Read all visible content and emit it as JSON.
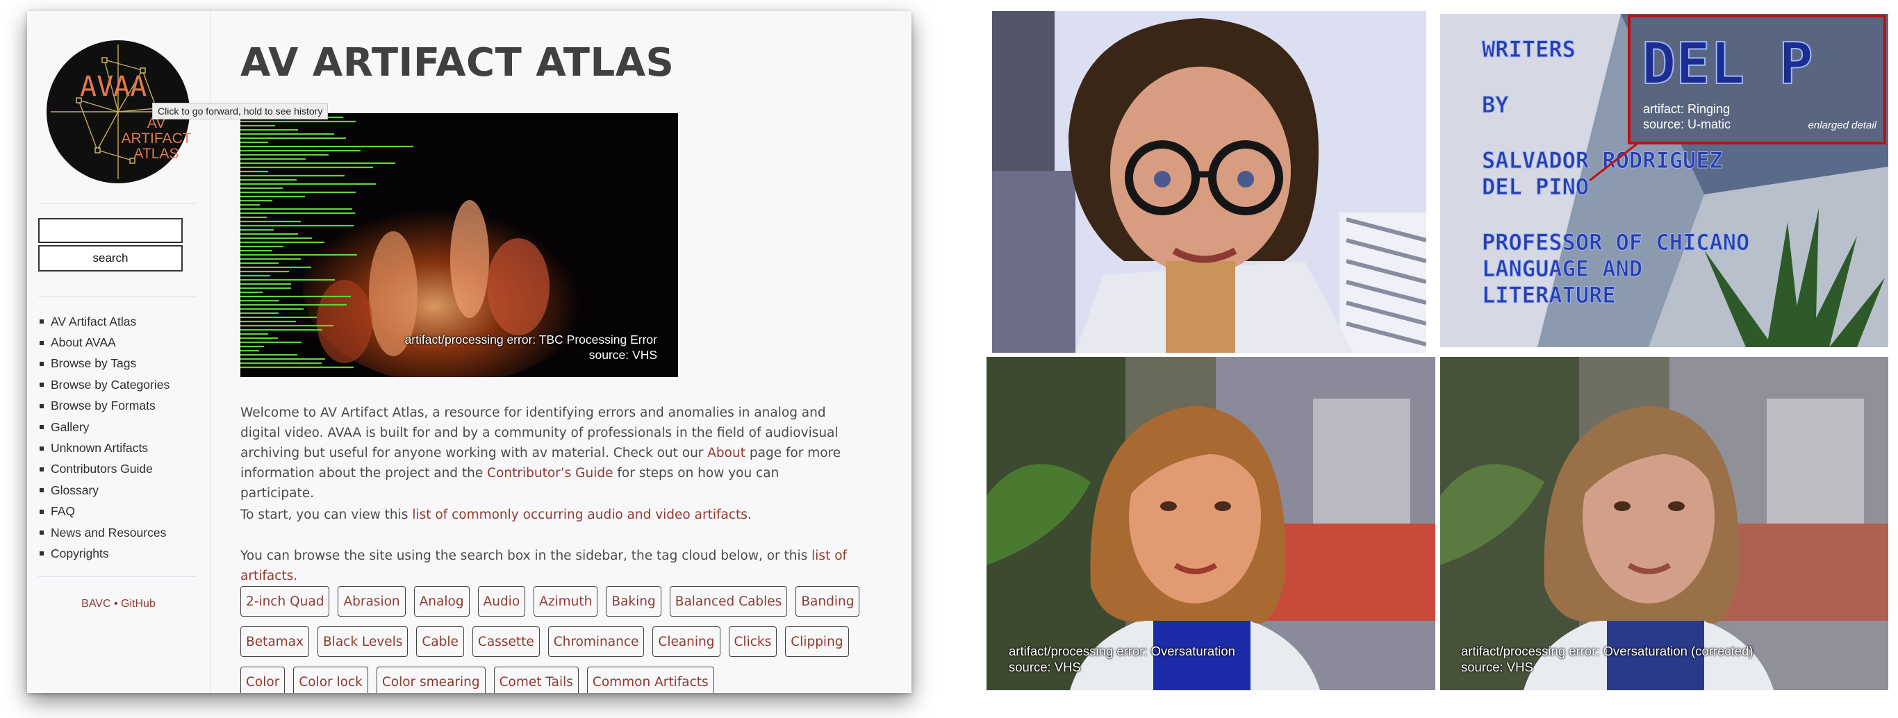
{
  "tooltip": "Click to go forward, hold to see history",
  "logo": {
    "top": "AVAA",
    "lines": [
      "AV",
      "ARTIFACT",
      "ATLAS"
    ]
  },
  "search": {
    "button_label": "search",
    "value": ""
  },
  "nav": [
    "AV Artifact Atlas",
    "About AVAA",
    "Browse by Tags",
    "Browse by Categories",
    "Browse by Formats",
    "Gallery",
    "Unknown Artifacts",
    "Contributors Guide",
    "Glossary",
    "FAQ",
    "News and Resources",
    "Copyrights"
  ],
  "footer": {
    "bavc": "BAVC",
    "separator": "•",
    "github": "GitHub"
  },
  "site_title": "AV ARTIFACT ATLAS",
  "hero": {
    "caption_line1": "artifact/processing error: TBC Processing Error",
    "caption_line2": "source: VHS"
  },
  "intro": {
    "part1": "Welcome to AV Artifact Atlas, a resource for identifying errors and anomalies in analog and digital video. AVAA is built for and by a community of professionals in the field of audiovisual archiving but useful for anyone working with av material. Check out our ",
    "about_link": "About",
    "part2": " page for more information about the project and the ",
    "guide_link": "Contributor’s Guide",
    "part3": " for steps on how you can participate."
  },
  "start": {
    "part1": "To start, you can view this ",
    "link": "list of commonly occurring audio and video artifacts",
    "part2": "."
  },
  "browse": {
    "part1": "You can browse the site using the search box in the sidebar, the tag cloud below, or this ",
    "link": "list of artifacts",
    "part2": "."
  },
  "tags": [
    "2-inch Quad",
    "Abrasion",
    "Analog",
    "Audio",
    "Azimuth",
    "Baking",
    "Balanced Cables",
    "Banding",
    "Betamax",
    "Black Levels",
    "Cable",
    "Cassette",
    "Chrominance",
    "Cleaning",
    "Clicks",
    "Clipping",
    "Color",
    "Color lock",
    "Color smearing",
    "Comet Tails",
    "Common Artifacts"
  ],
  "ringing_frame": {
    "title_lines": [
      "WRITERS",
      "BY",
      "SALVADOR RODRIGUEZ",
      "DEL PINO",
      "PROFESSOR OF CHICANO",
      "LANGUAGE AND",
      "LITERATURE"
    ],
    "inset_text": "DEL P",
    "caption_line1": "artifact: Ringing",
    "caption_line2": "source: U-matic",
    "enlarged": "enlarged detail"
  },
  "oversat_frame": {
    "caption_line1": "artifact/processing error: Oversaturation",
    "caption_line2": "source: VHS"
  },
  "corrected_frame": {
    "caption_line1": "artifact/processing error: Oversaturation (corrected)",
    "caption_line2": "source: VHS"
  },
  "colors": {
    "link": "#8f3a2e",
    "text": "#4a4a4a",
    "logo_ring": "#111111",
    "logo_text": "#e07a4c",
    "inset_border": "#c01010"
  }
}
